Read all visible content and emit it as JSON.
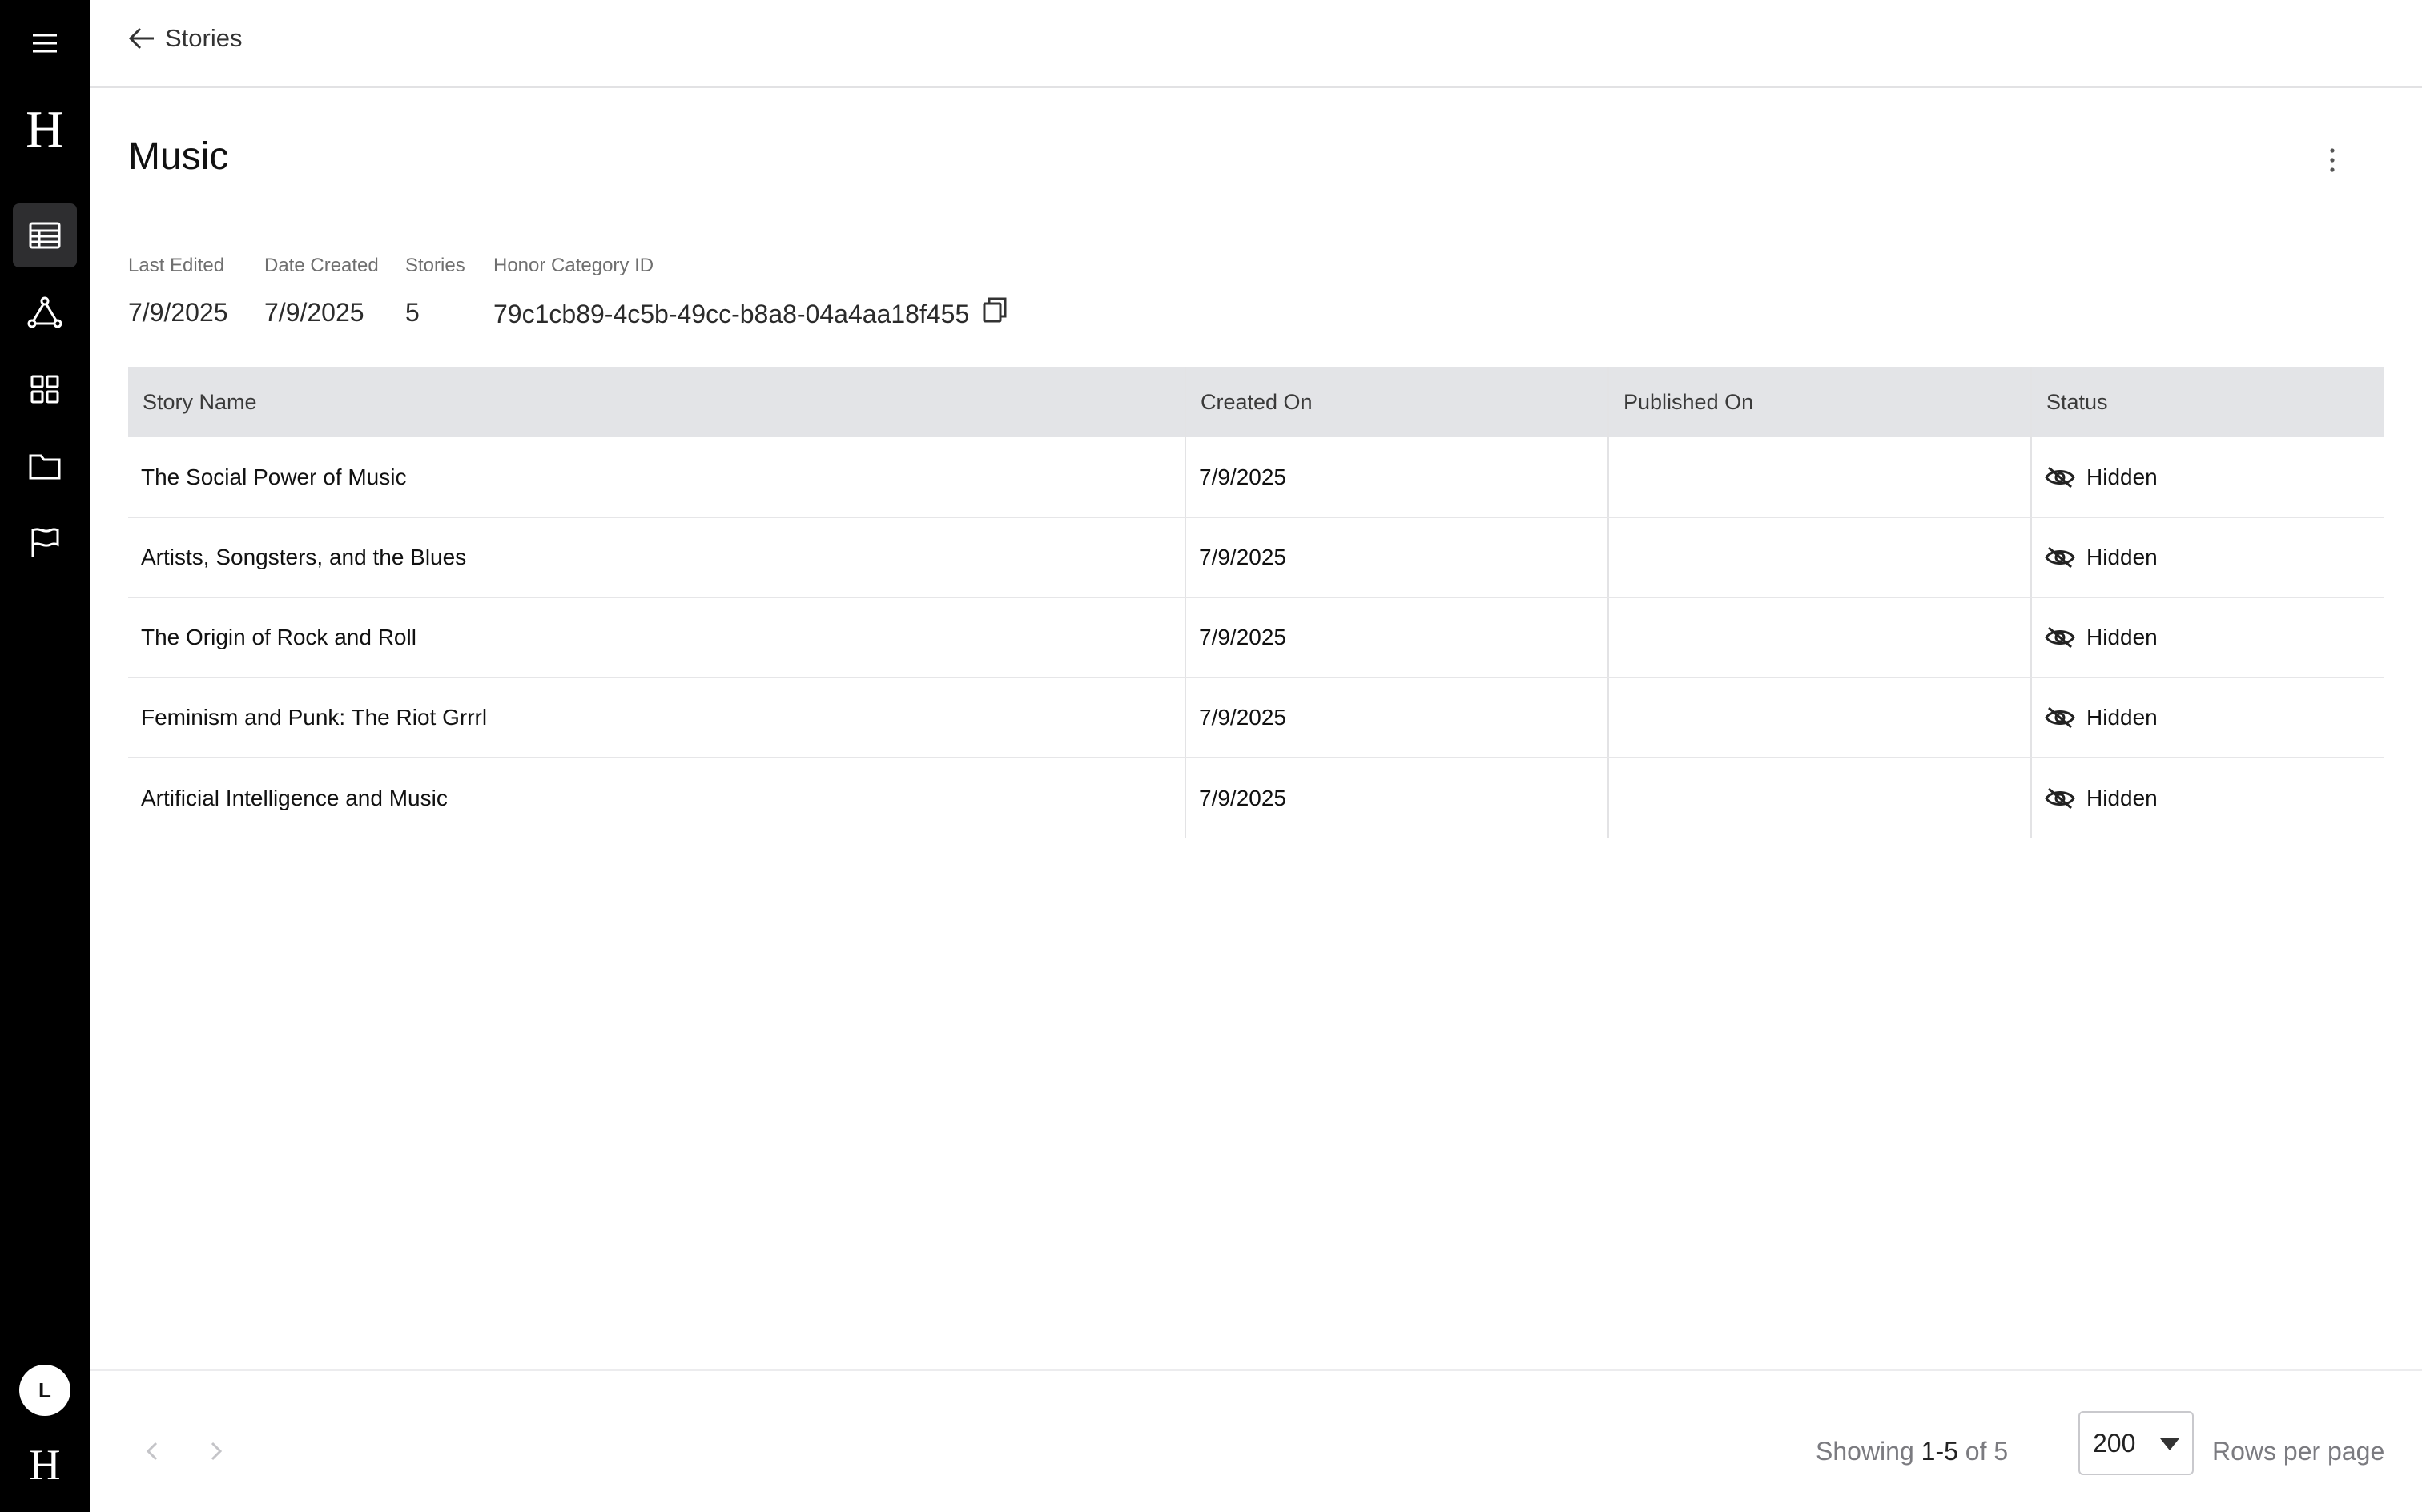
{
  "sidebar": {
    "menu_icon": "hamburger-menu-icon",
    "logo_text": "H",
    "items": [
      {
        "name": "table-icon",
        "active": true
      },
      {
        "name": "network-icon",
        "active": false
      },
      {
        "name": "grid-icon",
        "active": false
      },
      {
        "name": "folder-icon",
        "active": false
      },
      {
        "name": "flag-icon",
        "active": false
      }
    ],
    "avatar_initial": "L",
    "bottom_logo_text": "H"
  },
  "header": {
    "back_label": "Stories"
  },
  "page": {
    "title": "Music"
  },
  "meta": {
    "last_edited_label": "Last Edited",
    "last_edited_value": "7/9/2025",
    "date_created_label": "Date Created",
    "date_created_value": "7/9/2025",
    "stories_label": "Stories",
    "stories_value": "5",
    "category_id_label": "Honor Category ID",
    "category_id_value": "79c1cb89-4c5b-49cc-b8a8-04a4aa18f455"
  },
  "table": {
    "columns": [
      "Story Name",
      "Created On",
      "Published On",
      "Status"
    ],
    "rows": [
      {
        "name": "The Social Power of Music",
        "created": "7/9/2025",
        "published": "",
        "status": "Hidden"
      },
      {
        "name": "Artists, Songsters, and the Blues",
        "created": "7/9/2025",
        "published": "",
        "status": "Hidden"
      },
      {
        "name": "The Origin of Rock and Roll",
        "created": "7/9/2025",
        "published": "",
        "status": "Hidden"
      },
      {
        "name": "Feminism and Punk: The Riot Grrrl",
        "created": "7/9/2025",
        "published": "",
        "status": "Hidden"
      },
      {
        "name": "Artificial Intelligence and Music",
        "created": "7/9/2025",
        "published": "",
        "status": "Hidden"
      }
    ]
  },
  "footer": {
    "showing_prefix": "Showing",
    "showing_range": "1-5",
    "showing_of": "of",
    "showing_total": "5",
    "rows_per_page_value": "200",
    "rows_per_page_label": "Rows per page"
  }
}
